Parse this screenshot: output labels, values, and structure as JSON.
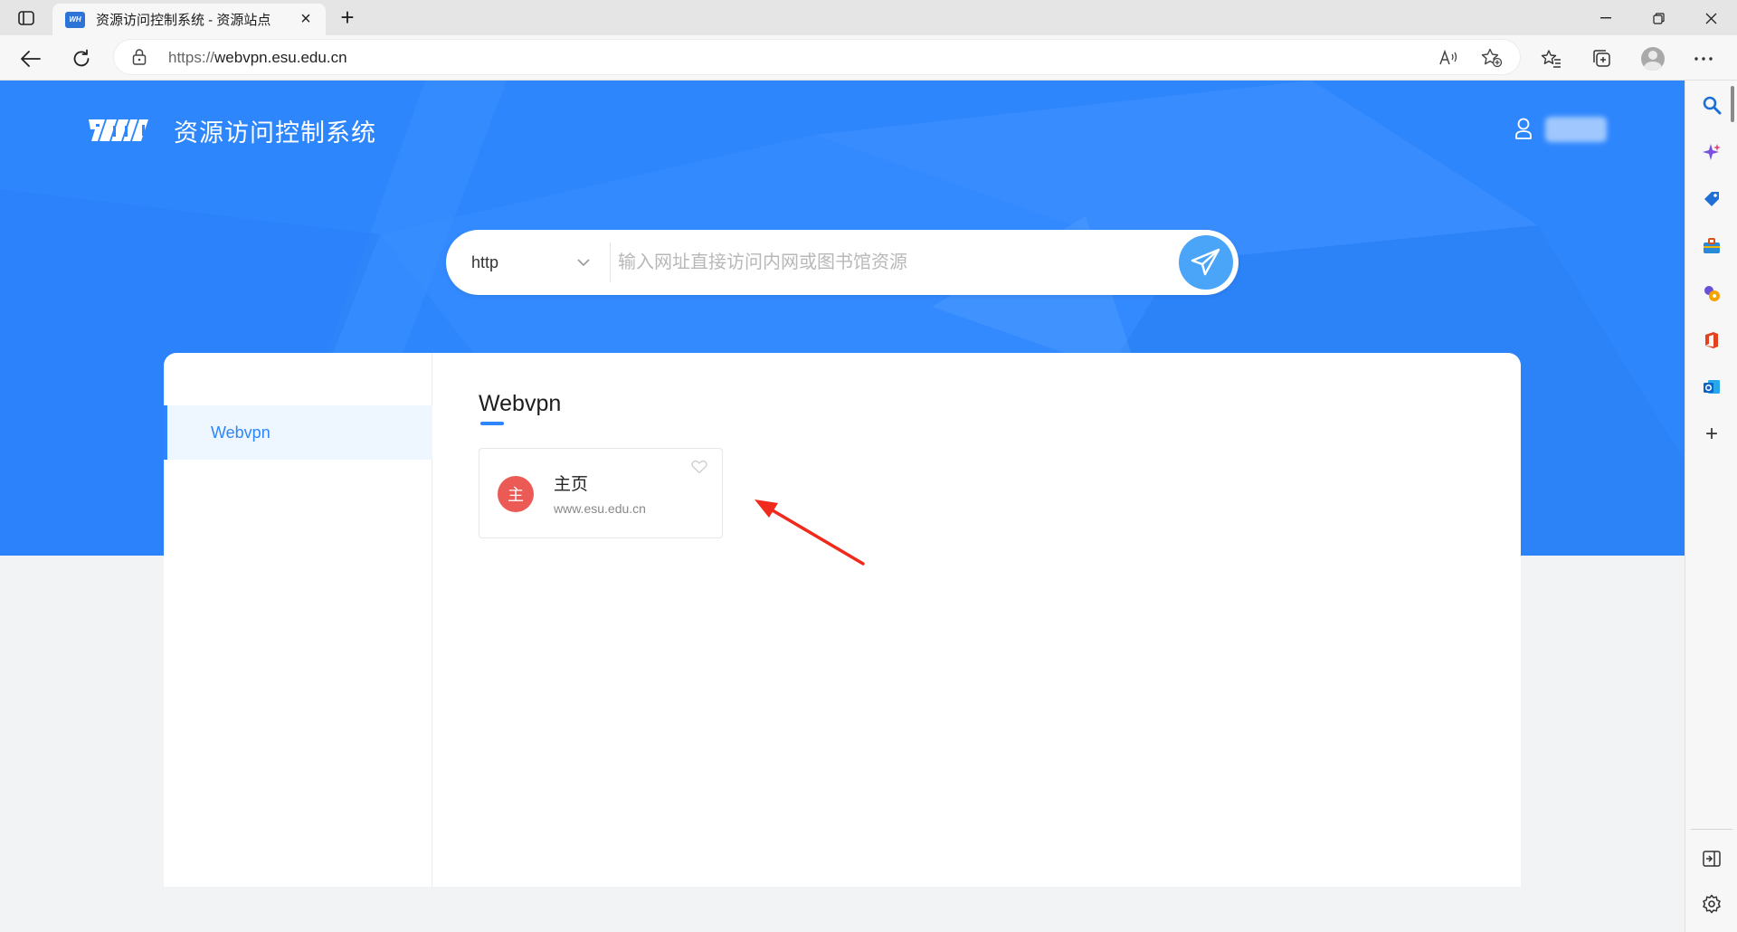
{
  "browser": {
    "tab_title": "资源访问控制系统 - 资源站点",
    "favicon_text": "WH",
    "url_scheme": "https://",
    "url_host": "webvpn.esu.edu.cn"
  },
  "header": {
    "logo_text": "WH",
    "system_title": "资源访问控制系统"
  },
  "search": {
    "protocol": "http",
    "placeholder": "输入网址直接访问内网或图书馆资源",
    "value": ""
  },
  "sidebar": {
    "items": [
      {
        "label": "Webvpn",
        "active": true
      }
    ]
  },
  "section": {
    "title": "Webvpn",
    "sites": [
      {
        "avatar_text": "主",
        "name": "主页",
        "url": "www.esu.edu.cn",
        "avatar_color": "#ec5a55"
      }
    ]
  },
  "colors": {
    "brand_blue": "#2e86fd",
    "annotation_arrow": "#f02a1c"
  },
  "icons": {
    "edge_sidebar": [
      "search-icon",
      "copilot-icon",
      "shopping-tag-icon",
      "tools-icon",
      "games-icon",
      "office-icon",
      "outlook-icon",
      "add-icon"
    ],
    "edge_sidebar_bottom": [
      "hide-sidebar-icon",
      "settings-icon"
    ]
  }
}
